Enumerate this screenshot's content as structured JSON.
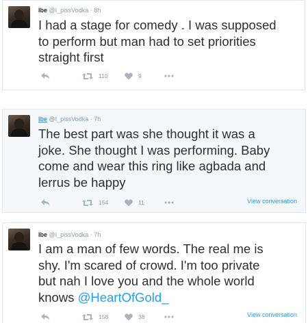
{
  "tweets": [
    {
      "name": "Ibe",
      "handle": "@I_pissVodka",
      "sep": "·",
      "time": "8h",
      "lines": [
        "I had a stage for comedy . I was supposed",
        "to perform but man had to set priorities",
        "straight first"
      ],
      "retweets": "110",
      "likes": "9",
      "view_conversation": ""
    },
    {
      "name": "Ibe",
      "handle": "@I_pissVodka",
      "sep": "·",
      "time": "7h",
      "lines": [
        "The best part was she thought it was a",
        "joke. She thought I was performing. Baby",
        "come and wear this ring like agbada and",
        "lerrus be happy"
      ],
      "retweets": "154",
      "likes": "11",
      "view_conversation": "View conversation"
    },
    {
      "name": "Ibe",
      "handle": "@I_pissVodka",
      "sep": "·",
      "time": "7h",
      "lines": [
        "I am a man of few words. The real me is",
        "shy. I'm scared of crowd. I'm too private",
        "but nah I love you and the whole world"
      ],
      "last_line_prefix": "knows ",
      "mention": "@HeartOfGold_",
      "retweets": "158",
      "likes": "38",
      "view_conversation": "View conversation"
    }
  ],
  "icons": {
    "reply": "reply-icon",
    "retweet": "retweet-icon",
    "like": "heart-icon",
    "more": "more-dots-icon"
  },
  "colors": {
    "text": "#292f33",
    "muted": "#8899a6",
    "link": "#3b94d9",
    "mention": "#1da1f2",
    "border": "#e1e8ed"
  }
}
